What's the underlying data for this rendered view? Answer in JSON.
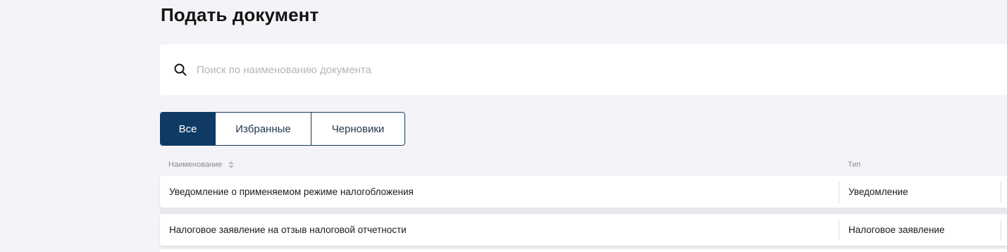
{
  "page": {
    "title": "Подать документ"
  },
  "search": {
    "placeholder": "Поиск по наименованию документа",
    "value": "",
    "icon": "search-icon"
  },
  "tabs": [
    {
      "label": "Все",
      "active": true
    },
    {
      "label": "Избранные",
      "active": false
    },
    {
      "label": "Черновики",
      "active": false
    }
  ],
  "table": {
    "columns": {
      "name": "Наименование",
      "type": "Тип"
    },
    "rows": [
      {
        "name": "Уведомление о применяемом режиме налогобложения",
        "type": "Уведомление"
      },
      {
        "name": "Налоговое заявление на отзыв налоговой отчетности",
        "type": "Налоговое заявление"
      }
    ]
  },
  "colors": {
    "accent": "#0f3a63",
    "background": "#f4f4f8",
    "surface": "#ffffff",
    "muted_text": "#8a8d95",
    "placeholder": "#b5b5bd"
  }
}
